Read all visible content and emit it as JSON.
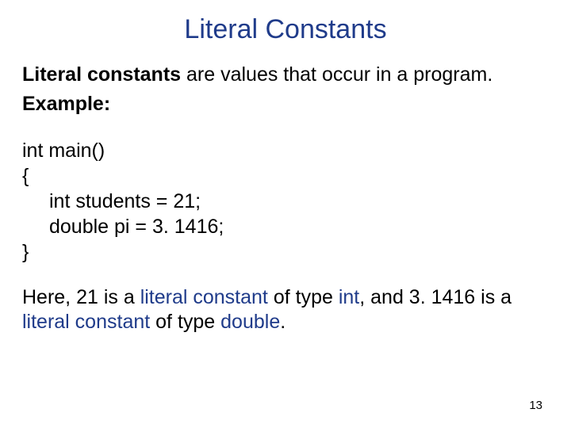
{
  "title": {
    "word1": "Literal",
    "word2": "Constants"
  },
  "intro": {
    "bold_lead": "Literal constants",
    "rest": " are values that occur in a program.",
    "example_label": "Example:"
  },
  "code": {
    "l1": "int main()",
    "l2": "{",
    "l3": "int students = 21;",
    "l4": "double pi = 3. 1416;",
    "l5": "}"
  },
  "closing": {
    "t1": "Here, 21 is a ",
    "kw_literal_constant_1": "literal constant",
    "t2": " of type ",
    "kw_int": "int",
    "t3": ", and 3. 1416 is a ",
    "kw_literal_constant_2": "literal constant",
    "t4": " of type ",
    "kw_double": "double",
    "t5": "."
  },
  "page_number": "13"
}
